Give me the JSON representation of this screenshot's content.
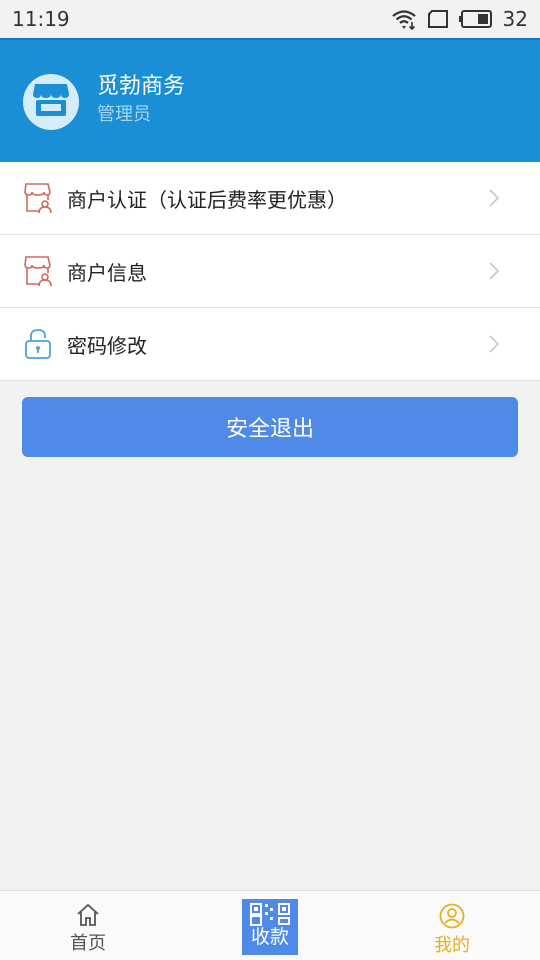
{
  "status_bar": {
    "time": "11:19",
    "battery": "32"
  },
  "header": {
    "store_name": "觅勃商务",
    "role": "管理员",
    "icon": "store-icon",
    "bg_color": "#1a8fd6"
  },
  "menu": [
    {
      "label": "商户认证（认证后费率更优惠）",
      "icon": "merchant-cert-icon"
    },
    {
      "label": "商户信息",
      "icon": "merchant-info-icon"
    },
    {
      "label": "密码修改",
      "icon": "lock-icon"
    }
  ],
  "logout": {
    "label": "安全退出",
    "color": "#4f8ae8"
  },
  "bottom_nav": {
    "home": {
      "label": "首页",
      "icon": "home-icon"
    },
    "collect": {
      "label": "收款",
      "icon": "qr-code-icon"
    },
    "me": {
      "label": "我的",
      "icon": "user-icon",
      "active_color": "#e6b01e"
    }
  }
}
